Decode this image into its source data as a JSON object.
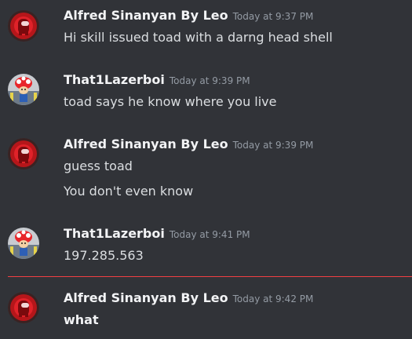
{
  "messages": [
    {
      "author": "Alfred Sinanyan By Leo",
      "timestamp": "Today at 9:37 PM",
      "lines": [
        "Hi skill issued toad with a darng head shell"
      ],
      "avatar_icon": "red-amogus-avatar-icon"
    },
    {
      "author": "That1Lazerboi",
      "timestamp": "Today at 9:39 PM",
      "lines": [
        "toad says he know where you live"
      ],
      "avatar_icon": "toad-avatar-icon"
    },
    {
      "author": "Alfred Sinanyan By Leo",
      "timestamp": "Today at 9:39 PM",
      "lines": [
        "guess toad",
        "You don't even know"
      ],
      "avatar_icon": "red-amogus-avatar-icon"
    },
    {
      "author": "That1Lazerboi",
      "timestamp": "Today at 9:41 PM",
      "lines": [
        "197.285.563"
      ],
      "avatar_icon": "toad-avatar-icon"
    },
    {
      "author": "Alfred Sinanyan By Leo",
      "timestamp": "Today at 9:42 PM",
      "lines": [
        "what"
      ],
      "avatar_icon": "red-amogus-avatar-icon"
    }
  ],
  "colors": {
    "background": "#313338",
    "username": "#f2f3f5",
    "timestamp": "#949ba4",
    "text": "#dbdee1",
    "new_divider": "#f23f42"
  }
}
